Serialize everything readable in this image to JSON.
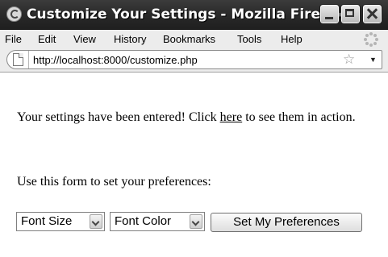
{
  "window": {
    "title": "Customize Your Settings - Mozilla Firefox"
  },
  "menubar": {
    "items": [
      {
        "label": "File"
      },
      {
        "label": "Edit"
      },
      {
        "label": "View"
      },
      {
        "label": "History"
      },
      {
        "label": "Bookmarks"
      },
      {
        "label": "Tools"
      },
      {
        "label": "Help"
      }
    ]
  },
  "navbar": {
    "url": "http://localhost:8000/customize.php"
  },
  "page": {
    "message_before_link": "Your settings have been entered! Click ",
    "link_text": "here",
    "message_after_link": " to see them in action.",
    "form_intro": "Use this form to set your preferences:",
    "font_size_select": "Font Size",
    "font_color_select": "Font Color",
    "submit_label": "Set My Preferences"
  },
  "colors": {
    "titlebar": "#2b2b2b",
    "chrome": "#ececec",
    "content_bg": "#ffffff"
  }
}
